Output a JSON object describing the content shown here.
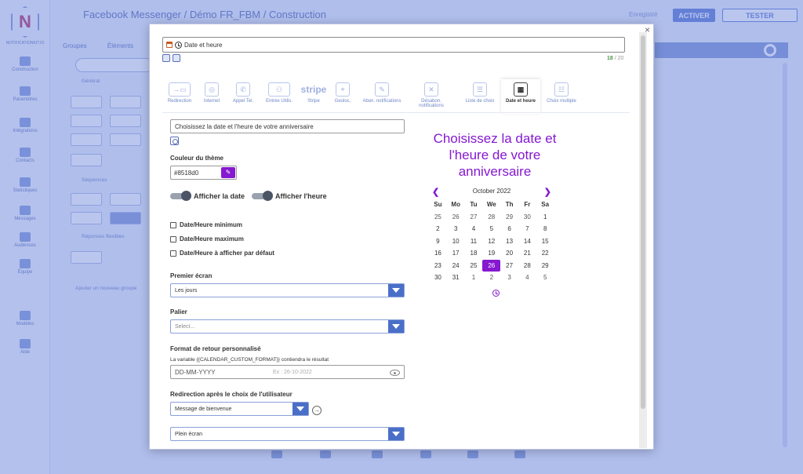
{
  "background": {
    "logo_text": "NOTIFICATIONKIT.IO",
    "breadcrumb": "Facebook Messenger / Démo FR_FBM / Construction",
    "top_buttons": [
      "ACTIVER",
      "TESTER"
    ],
    "top_muted": "Enregistré",
    "tabs": [
      "Groupes",
      "Éléments"
    ],
    "sidebar": [
      "Construction",
      "Paramètres",
      "Intégrations",
      "Contacts",
      "Statistiques",
      "Messages",
      "Audiences",
      "Équipe",
      "Modèles",
      "Aide"
    ],
    "section_labels": [
      "Général",
      "Séquences",
      "Réponses flexibles"
    ],
    "bottom_note": "Ajouter un nouveau groupe"
  },
  "modal": {
    "close": "×",
    "title_value": "Date et heure",
    "char_count": "18",
    "char_max": "/ 20",
    "tools": [
      {
        "label": "Redirection",
        "icon": "→▭"
      },
      {
        "label": "Internet",
        "icon": "◎"
      },
      {
        "label": "Appel Tel.",
        "icon": "✆"
      },
      {
        "label": "Entrée Utilis.",
        "icon": "⚇"
      },
      {
        "label": "Stripe",
        "icon": "stripe"
      },
      {
        "label": "Geoloc.",
        "icon": "⌖"
      },
      {
        "label": "Abon. notifications",
        "icon": "✎"
      },
      {
        "label": "Désabon. notifications",
        "icon": "✕"
      },
      {
        "label": "Liste de choix",
        "icon": "☰"
      },
      {
        "label": "Date et heure",
        "icon": "▦"
      },
      {
        "label": "Choix multiple",
        "icon": "☷"
      }
    ],
    "question_value": "Choisissez la date et l'heure de votre anniversaire",
    "theme_color_label": "Couleur du thème",
    "theme_color_value": "#8518d0",
    "picker_icon": "✎",
    "toggle_date": "Afficher la date",
    "toggle_time": "Afficher l'heure",
    "check_min": "Date/Heure minimum",
    "check_max": "Date/Heure maximum",
    "check_default": "Date/Heure à afficher par défaut",
    "first_screen_label": "Premier écran",
    "first_screen_value": "Les jours",
    "step_label": "Palier",
    "step_value": "Select...",
    "format_label": "Format de retour personnalisé",
    "format_note": "La variable {{CALENDAR_CUSTOM_FORMAT}} contiendra le résultat",
    "format_value": "DD-MM-YYYY",
    "format_example": "Ex : 26-10-2022",
    "redirect_label": "Redirection après le choix de l'utilisateur",
    "redirect_value": "Message de bienvenue",
    "go_icon": "→",
    "display_value": "Plein écran"
  },
  "preview": {
    "title": "Choisissez la date et l'heure de votre anniversaire",
    "month": "October 2022",
    "prev": "❮",
    "next": "❯",
    "weekdays": [
      "Su",
      "Mo",
      "Tu",
      "We",
      "Th",
      "Fr",
      "Sa"
    ],
    "weeks": [
      [
        "25",
        "26",
        "27",
        "28",
        "29",
        "30",
        "1"
      ],
      [
        "2",
        "3",
        "4",
        "5",
        "6",
        "7",
        "8"
      ],
      [
        "9",
        "10",
        "11",
        "12",
        "13",
        "14",
        "15"
      ],
      [
        "16",
        "17",
        "18",
        "19",
        "20",
        "21",
        "22"
      ],
      [
        "23",
        "24",
        "25",
        "26",
        "27",
        "28",
        "29"
      ],
      [
        "30",
        "31",
        "1",
        "2",
        "3",
        "4",
        "5"
      ]
    ],
    "selected": "26"
  },
  "colors": {
    "accent": "#8518d0",
    "select_arrow": "#4a6fc8"
  }
}
